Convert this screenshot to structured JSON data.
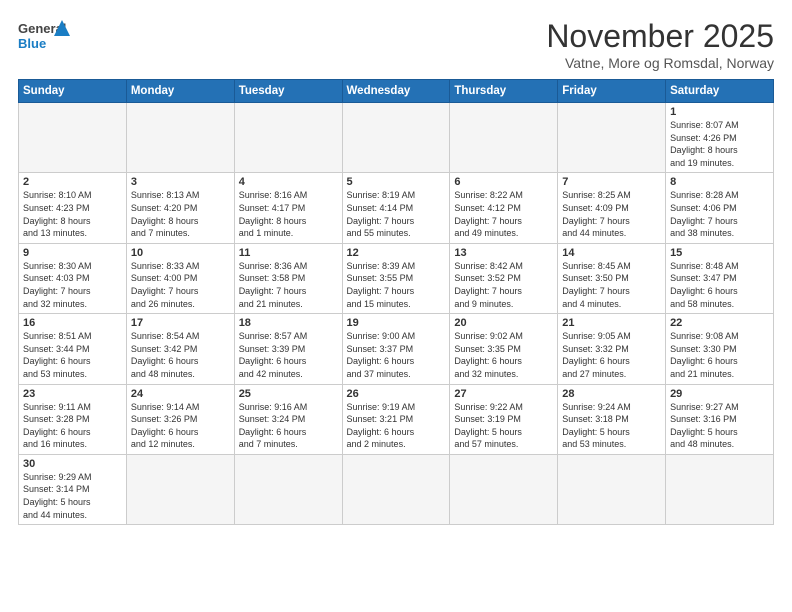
{
  "header": {
    "logo_general": "General",
    "logo_blue": "Blue",
    "month_title": "November 2025",
    "location": "Vatne, More og Romsdal, Norway"
  },
  "weekdays": [
    "Sunday",
    "Monday",
    "Tuesday",
    "Wednesday",
    "Thursday",
    "Friday",
    "Saturday"
  ],
  "weeks": [
    [
      {
        "day": "",
        "info": ""
      },
      {
        "day": "",
        "info": ""
      },
      {
        "day": "",
        "info": ""
      },
      {
        "day": "",
        "info": ""
      },
      {
        "day": "",
        "info": ""
      },
      {
        "day": "",
        "info": ""
      },
      {
        "day": "1",
        "info": "Sunrise: 8:07 AM\nSunset: 4:26 PM\nDaylight: 8 hours\nand 19 minutes."
      }
    ],
    [
      {
        "day": "2",
        "info": "Sunrise: 8:10 AM\nSunset: 4:23 PM\nDaylight: 8 hours\nand 13 minutes."
      },
      {
        "day": "3",
        "info": "Sunrise: 8:13 AM\nSunset: 4:20 PM\nDaylight: 8 hours\nand 7 minutes."
      },
      {
        "day": "4",
        "info": "Sunrise: 8:16 AM\nSunset: 4:17 PM\nDaylight: 8 hours\nand 1 minute."
      },
      {
        "day": "5",
        "info": "Sunrise: 8:19 AM\nSunset: 4:14 PM\nDaylight: 7 hours\nand 55 minutes."
      },
      {
        "day": "6",
        "info": "Sunrise: 8:22 AM\nSunset: 4:12 PM\nDaylight: 7 hours\nand 49 minutes."
      },
      {
        "day": "7",
        "info": "Sunrise: 8:25 AM\nSunset: 4:09 PM\nDaylight: 7 hours\nand 44 minutes."
      },
      {
        "day": "8",
        "info": "Sunrise: 8:28 AM\nSunset: 4:06 PM\nDaylight: 7 hours\nand 38 minutes."
      }
    ],
    [
      {
        "day": "9",
        "info": "Sunrise: 8:30 AM\nSunset: 4:03 PM\nDaylight: 7 hours\nand 32 minutes."
      },
      {
        "day": "10",
        "info": "Sunrise: 8:33 AM\nSunset: 4:00 PM\nDaylight: 7 hours\nand 26 minutes."
      },
      {
        "day": "11",
        "info": "Sunrise: 8:36 AM\nSunset: 3:58 PM\nDaylight: 7 hours\nand 21 minutes."
      },
      {
        "day": "12",
        "info": "Sunrise: 8:39 AM\nSunset: 3:55 PM\nDaylight: 7 hours\nand 15 minutes."
      },
      {
        "day": "13",
        "info": "Sunrise: 8:42 AM\nSunset: 3:52 PM\nDaylight: 7 hours\nand 9 minutes."
      },
      {
        "day": "14",
        "info": "Sunrise: 8:45 AM\nSunset: 3:50 PM\nDaylight: 7 hours\nand 4 minutes."
      },
      {
        "day": "15",
        "info": "Sunrise: 8:48 AM\nSunset: 3:47 PM\nDaylight: 6 hours\nand 58 minutes."
      }
    ],
    [
      {
        "day": "16",
        "info": "Sunrise: 8:51 AM\nSunset: 3:44 PM\nDaylight: 6 hours\nand 53 minutes."
      },
      {
        "day": "17",
        "info": "Sunrise: 8:54 AM\nSunset: 3:42 PM\nDaylight: 6 hours\nand 48 minutes."
      },
      {
        "day": "18",
        "info": "Sunrise: 8:57 AM\nSunset: 3:39 PM\nDaylight: 6 hours\nand 42 minutes."
      },
      {
        "day": "19",
        "info": "Sunrise: 9:00 AM\nSunset: 3:37 PM\nDaylight: 6 hours\nand 37 minutes."
      },
      {
        "day": "20",
        "info": "Sunrise: 9:02 AM\nSunset: 3:35 PM\nDaylight: 6 hours\nand 32 minutes."
      },
      {
        "day": "21",
        "info": "Sunrise: 9:05 AM\nSunset: 3:32 PM\nDaylight: 6 hours\nand 27 minutes."
      },
      {
        "day": "22",
        "info": "Sunrise: 9:08 AM\nSunset: 3:30 PM\nDaylight: 6 hours\nand 21 minutes."
      }
    ],
    [
      {
        "day": "23",
        "info": "Sunrise: 9:11 AM\nSunset: 3:28 PM\nDaylight: 6 hours\nand 16 minutes."
      },
      {
        "day": "24",
        "info": "Sunrise: 9:14 AM\nSunset: 3:26 PM\nDaylight: 6 hours\nand 12 minutes."
      },
      {
        "day": "25",
        "info": "Sunrise: 9:16 AM\nSunset: 3:24 PM\nDaylight: 6 hours\nand 7 minutes."
      },
      {
        "day": "26",
        "info": "Sunrise: 9:19 AM\nSunset: 3:21 PM\nDaylight: 6 hours\nand 2 minutes."
      },
      {
        "day": "27",
        "info": "Sunrise: 9:22 AM\nSunset: 3:19 PM\nDaylight: 5 hours\nand 57 minutes."
      },
      {
        "day": "28",
        "info": "Sunrise: 9:24 AM\nSunset: 3:18 PM\nDaylight: 5 hours\nand 53 minutes."
      },
      {
        "day": "29",
        "info": "Sunrise: 9:27 AM\nSunset: 3:16 PM\nDaylight: 5 hours\nand 48 minutes."
      }
    ],
    [
      {
        "day": "30",
        "info": "Sunrise: 9:29 AM\nSunset: 3:14 PM\nDaylight: 5 hours\nand 44 minutes."
      },
      {
        "day": "",
        "info": ""
      },
      {
        "day": "",
        "info": ""
      },
      {
        "day": "",
        "info": ""
      },
      {
        "day": "",
        "info": ""
      },
      {
        "day": "",
        "info": ""
      },
      {
        "day": "",
        "info": ""
      }
    ]
  ]
}
